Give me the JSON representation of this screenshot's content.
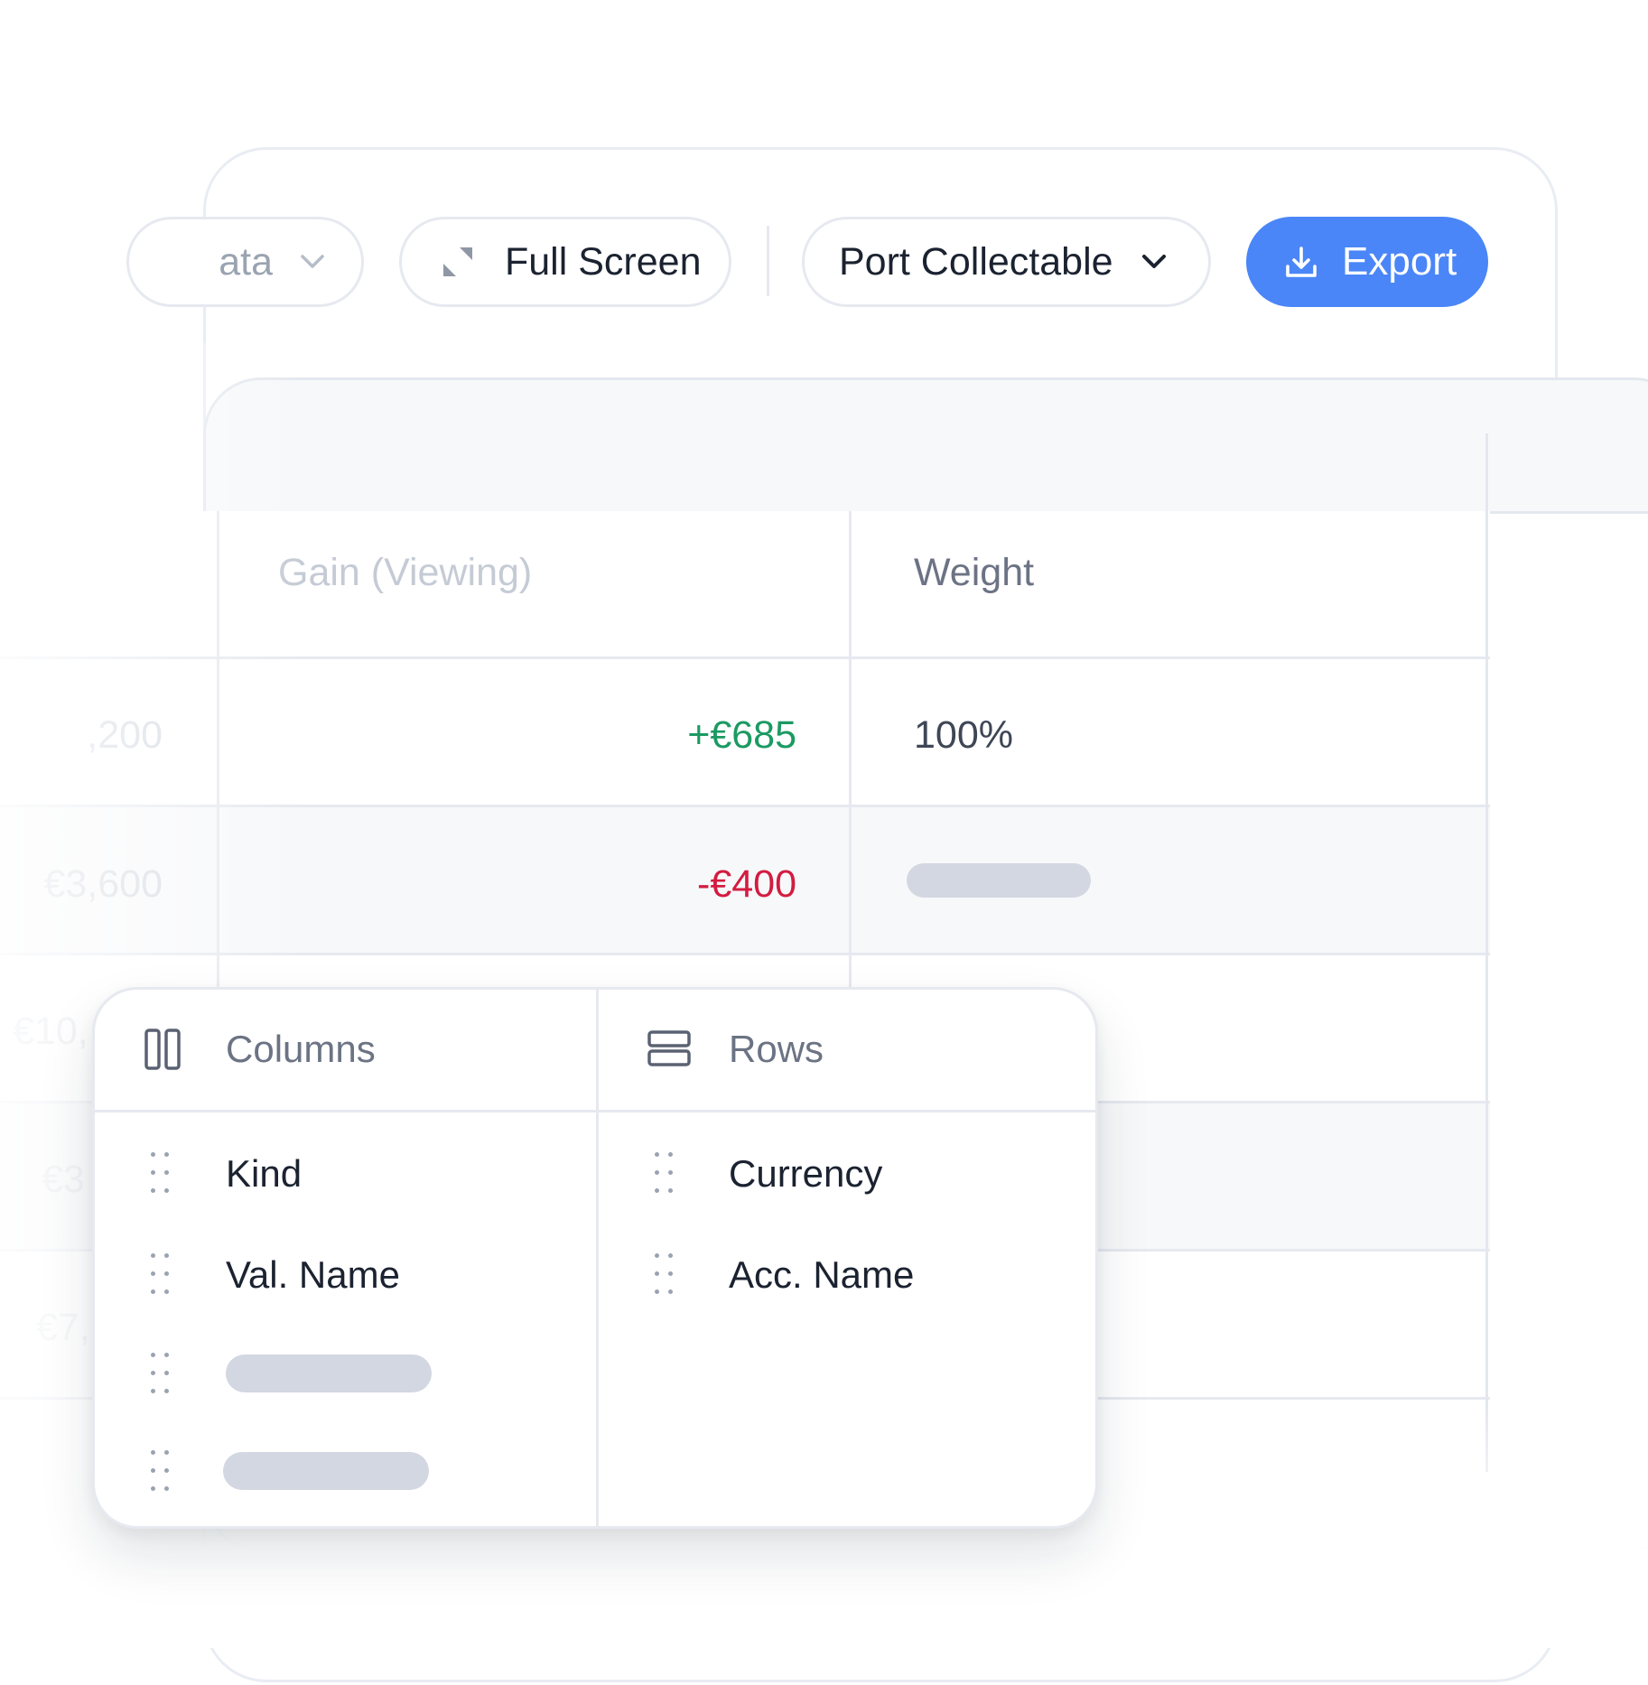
{
  "toolbar": {
    "data_pill_label": "ata",
    "fullscreen_label": "Full Screen",
    "portfolio_label": "Port Collectable",
    "export_label": "Export"
  },
  "table": {
    "headers": {
      "gain": "Gain (Viewing)",
      "weight": "Weight"
    },
    "left_values": [
      ",200",
      "€3,600",
      "€10,",
      "€3",
      "€7,"
    ],
    "rows": [
      {
        "gain": "+€685",
        "weight": "100%"
      },
      {
        "gain": "-€400",
        "weight": ""
      }
    ]
  },
  "pivot_card": {
    "columns_title": "Columns",
    "rows_title": "Rows",
    "columns": [
      "Kind",
      "Val. Name",
      "",
      ""
    ],
    "rows": [
      "Currency",
      "Acc. Name"
    ]
  },
  "colors": {
    "accent": "#4a86f7",
    "positive": "#1b9a62",
    "negative": "#d31c40",
    "placeholder": "#d2d7e1"
  }
}
